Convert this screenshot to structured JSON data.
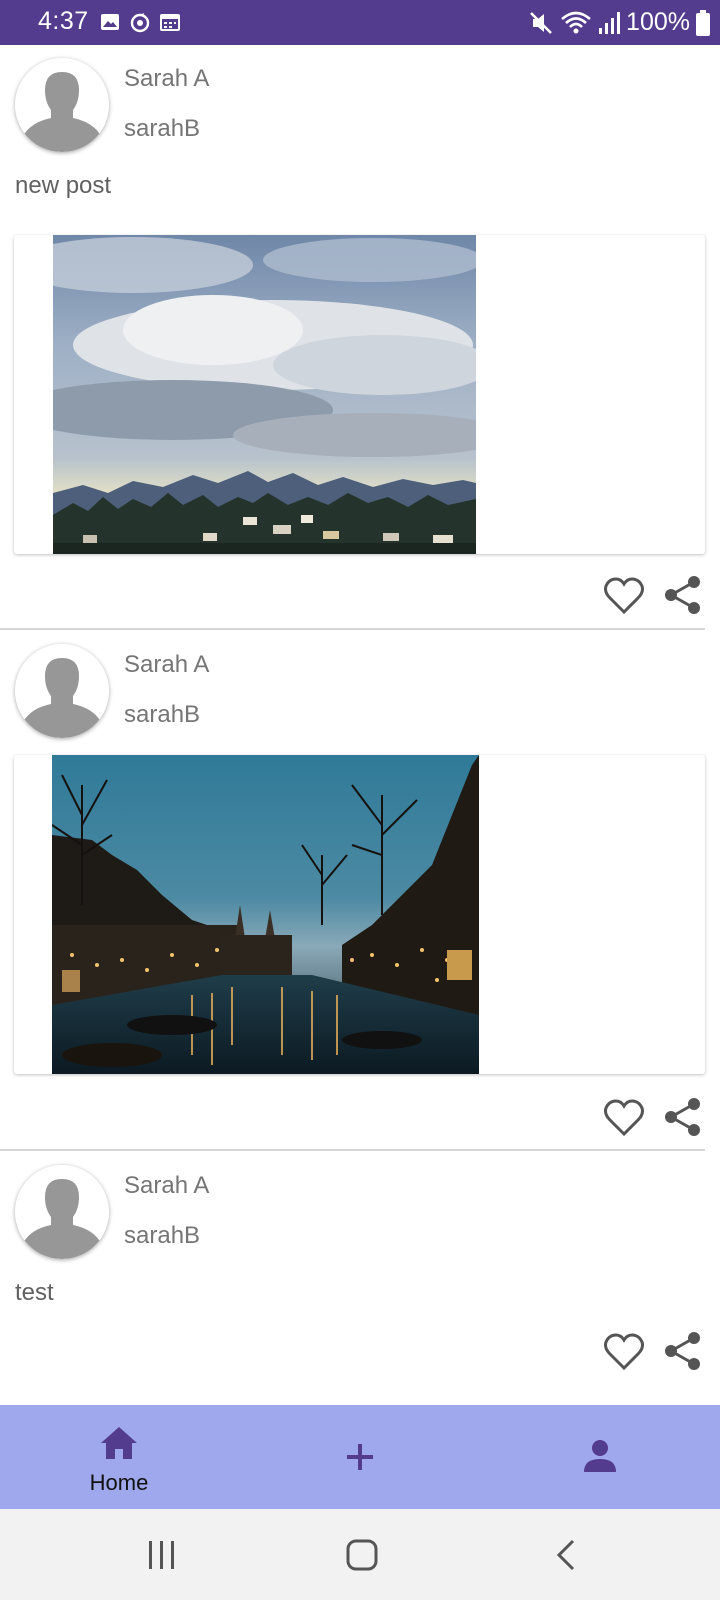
{
  "status_bar": {
    "time": "4:37",
    "battery": "100%",
    "left_icons": [
      "gallery-icon",
      "sync-icon",
      "calendar-icon"
    ],
    "right_icons": [
      "mute-icon",
      "wifi-icon",
      "signal-icon",
      "battery-icon"
    ],
    "background": "#533c8e"
  },
  "posts": [
    {
      "display_name": "Sarah A",
      "username": "sarahB",
      "text": "new post",
      "image": "mountain-landscape"
    },
    {
      "display_name": "Sarah A",
      "username": "sarahB",
      "text": "",
      "image": "canal-at-night"
    },
    {
      "display_name": "Sarah A",
      "username": "sarahB",
      "text": "test",
      "image": ""
    }
  ],
  "bottom_nav": {
    "items": [
      {
        "label": "Home",
        "icon": "home-icon"
      },
      {
        "label": "",
        "icon": "add-icon"
      },
      {
        "label": "",
        "icon": "profile-icon"
      }
    ],
    "background": "#9fa8ec",
    "icon_color": "#533c8e"
  },
  "system_nav": {
    "buttons": [
      "recents-icon",
      "home-circle-icon",
      "back-icon"
    ]
  }
}
